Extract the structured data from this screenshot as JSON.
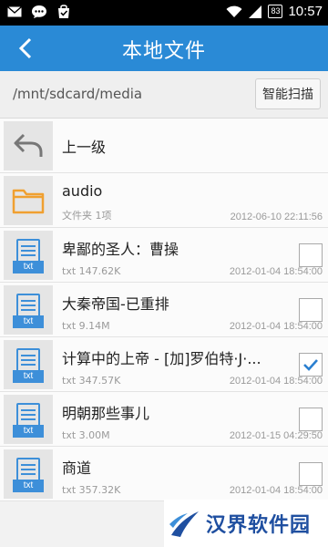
{
  "status_bar": {
    "time": "10:57",
    "battery": "83"
  },
  "app_bar": {
    "title": "本地文件"
  },
  "path_bar": {
    "path": "/mnt/sdcard/media",
    "scan_label": "智能扫描"
  },
  "up_item": {
    "label": "上一级"
  },
  "folder": {
    "name": "audio",
    "meta": "文件夹  1项",
    "date": "2012-06-10 22:11:56"
  },
  "files": [
    {
      "name": "卑鄙的圣人：曹操",
      "meta": "txt  147.62K",
      "date": "2012-01-04 18:54:00",
      "checked": false,
      "icon_label": "txt"
    },
    {
      "name": "大秦帝国-已重排",
      "meta": "txt  9.14M",
      "date": "2012-01-04 18:54:00",
      "checked": false,
      "icon_label": "txt"
    },
    {
      "name": "计算中的上帝 - [加]罗伯特·J·...",
      "meta": "txt  347.57K",
      "date": "2012-01-04 18:54:00",
      "checked": true,
      "icon_label": "txt"
    },
    {
      "name": "明朝那些事儿",
      "meta": "txt  3.00M",
      "date": "2012-01-15 04:29:50",
      "checked": false,
      "icon_label": "txt"
    },
    {
      "name": "商道",
      "meta": "txt  357.32K",
      "date": "2012-01-04 18:54:00",
      "checked": false,
      "icon_label": "txt"
    }
  ],
  "watermark": {
    "text": "汉界软件园"
  },
  "colors": {
    "accent": "#2a8ad6",
    "folder": "#f0a030",
    "check": "#2a7fd0"
  }
}
